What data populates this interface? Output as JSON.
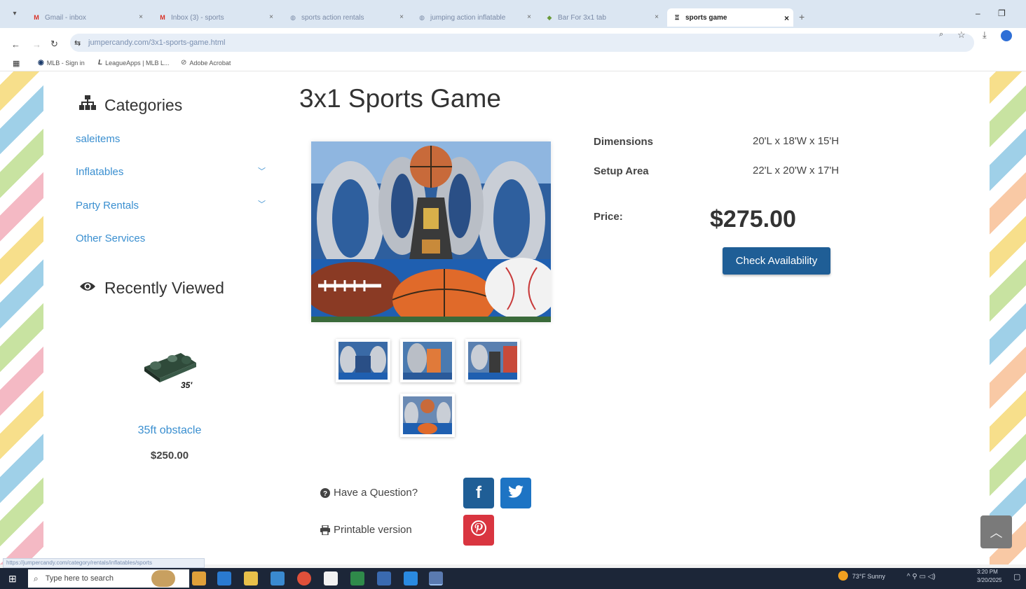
{
  "browser": {
    "tabs": [
      {
        "label": "Gmail - inbox"
      },
      {
        "label": "Inbox (3) - sports"
      },
      {
        "label": "sports action rentals"
      },
      {
        "label": "jumping action inflatable"
      },
      {
        "label": "Bar For 3x1 tab"
      },
      {
        "label": "sports game"
      }
    ],
    "address": "jumpercandy.com/3x1-sports-game.html",
    "bookmarks": [
      {
        "label": "MLB - Sign in"
      },
      {
        "label": "LeagueApps | MLB L..."
      },
      {
        "label": "Adobe Acrobat"
      }
    ],
    "status_url": "https://jumpercandy.com/category/rentals/inflatables/sports"
  },
  "sidebar": {
    "categories_title": "Categories",
    "categories": [
      {
        "label": "saleitems"
      },
      {
        "label": "Inflatables"
      },
      {
        "label": "Party Rentals"
      },
      {
        "label": "Other Services"
      }
    ],
    "recently_viewed_title": "Recently Viewed",
    "recent_item": {
      "name": "35ft obstacle",
      "price": "$250.00",
      "badge": "35'"
    }
  },
  "product": {
    "title": "3x1 Sports Game",
    "specs": [
      {
        "label": "Dimensions",
        "value": "20'L x 18'W x 15'H"
      },
      {
        "label": "Setup Area",
        "value": "22'L x 20'W x 17'H"
      }
    ],
    "price_label": "Price:",
    "price": "$275.00",
    "check_button": "Check Availability",
    "question_link": "Have a Question?",
    "print_link": "Printable version"
  },
  "taskbar": {
    "search_placeholder": "Type here to search",
    "weather": "73°F Sunny",
    "time": "3:20 PM",
    "date": "3/20/2025"
  },
  "colors": {
    "link": "#3a8fd0",
    "button": "#1f5e96",
    "facebook": "#1f5e96",
    "twitter": "#1d74c4",
    "pinterest": "#d93540",
    "taskbar": "#1c2638"
  }
}
